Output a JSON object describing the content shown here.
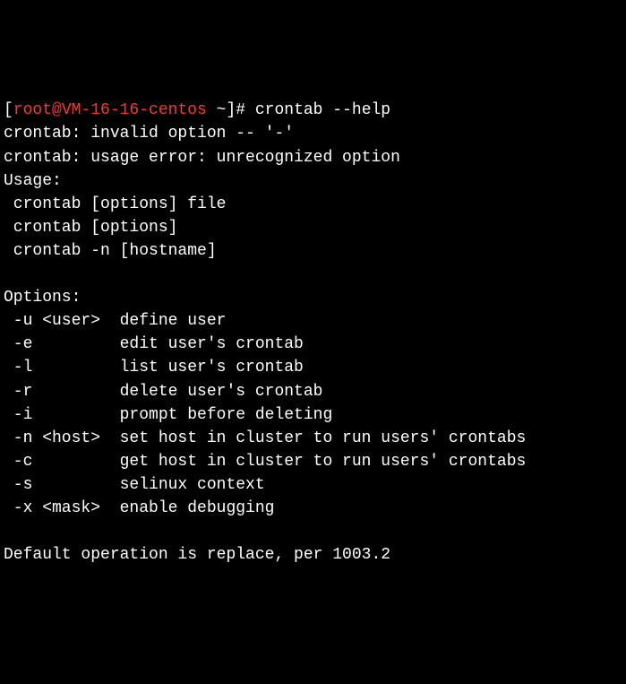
{
  "prompt": {
    "open": "[",
    "userhost": "root@VM-16-16-centos",
    "path": " ~",
    "close": "]# ",
    "command": "crontab --help"
  },
  "lines": {
    "err1": "crontab: invalid option -- '-'",
    "err2": "crontab: usage error: unrecognized option",
    "usage_hdr": "Usage:",
    "usage1": " crontab [options] file",
    "usage2": " crontab [options]",
    "usage3": " crontab -n [hostname]",
    "blank": "",
    "opts_hdr": "Options:",
    "opt_u": " -u <user>  define user",
    "opt_e": " -e         edit user's crontab",
    "opt_l": " -l         list user's crontab",
    "opt_r": " -r         delete user's crontab",
    "opt_i": " -i         prompt before deleting",
    "opt_n": " -n <host>  set host in cluster to run users' crontabs",
    "opt_c": " -c         get host in cluster to run users' crontabs",
    "opt_s": " -s         selinux context",
    "opt_x": " -x <mask>  enable debugging",
    "default": "Default operation is replace, per 1003.2"
  }
}
